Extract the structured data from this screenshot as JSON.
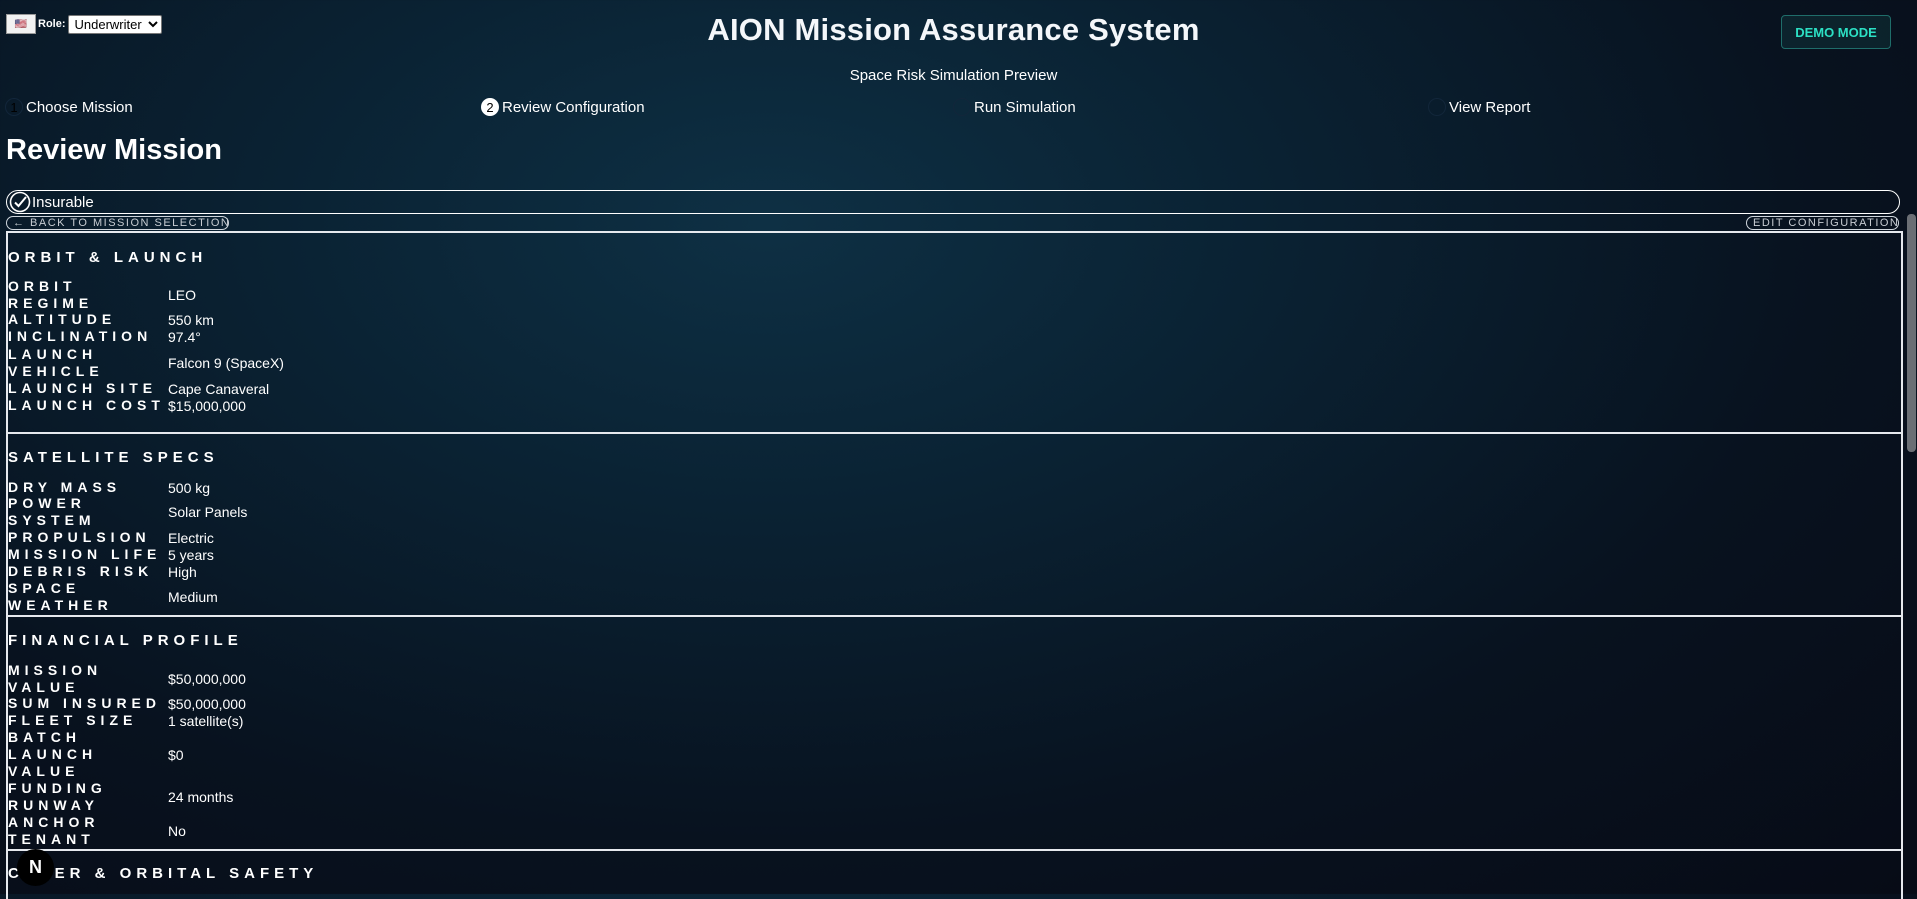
{
  "header": {
    "role_label": "Role:",
    "role_selected": "Underwriter",
    "title": "AION Mission Assurance System",
    "subtitle": "Space Risk Simulation Preview",
    "demo_mode": "DEMO MODE"
  },
  "steps": [
    {
      "number": "1",
      "label": "Choose Mission"
    },
    {
      "number": "2",
      "label": "Review Configuration"
    },
    {
      "number": "",
      "label": "Run Simulation"
    },
    {
      "number": "",
      "label": "View Report"
    }
  ],
  "page": {
    "title": "Review Mission",
    "status": "Insurable",
    "back_link": "← BACK TO MISSION SELECTION",
    "edit_link": "EDIT CONFIGURATION"
  },
  "sections": {
    "orbit": {
      "title": "ORBIT & LAUNCH",
      "rows": [
        {
          "label": "Orbit Regime",
          "value": "LEO"
        },
        {
          "label": "Altitude",
          "value": "550 km"
        },
        {
          "label": "Inclination",
          "value": "97.4°"
        },
        {
          "label": "Launch Vehicle",
          "value": "Falcon 9 (SpaceX)"
        },
        {
          "label": "Launch Site",
          "value": "Cape Canaveral"
        },
        {
          "label": "Launch Cost",
          "value": "$15,000,000"
        }
      ]
    },
    "satellite": {
      "title": "SATELLITE SPECS",
      "rows": [
        {
          "label": "Dry Mass",
          "value": "500 kg"
        },
        {
          "label": "Power System",
          "value": "Solar Panels"
        },
        {
          "label": "Propulsion",
          "value": "Electric"
        },
        {
          "label": "Mission Life",
          "value": "5 years"
        },
        {
          "label": "Debris Risk",
          "value": "High"
        },
        {
          "label": "Space Weather",
          "value": "Medium"
        }
      ]
    },
    "financial": {
      "title": "FINANCIAL PROFILE",
      "rows": [
        {
          "label": "Mission Value",
          "value": "$50,000,000"
        },
        {
          "label": "Sum Insured",
          "value": "$50,000,000"
        },
        {
          "label": "Fleet Size",
          "value": "1 satellite(s)"
        },
        {
          "label": "Batch Launch Value",
          "value": "$0"
        },
        {
          "label": "Funding Runway",
          "value": "24 months"
        },
        {
          "label": "Anchor Tenant",
          "value": "No"
        }
      ]
    },
    "cyber": {
      "title": "CYBER & ORBITAL SAFETY"
    }
  },
  "overlay_badge": "N"
}
